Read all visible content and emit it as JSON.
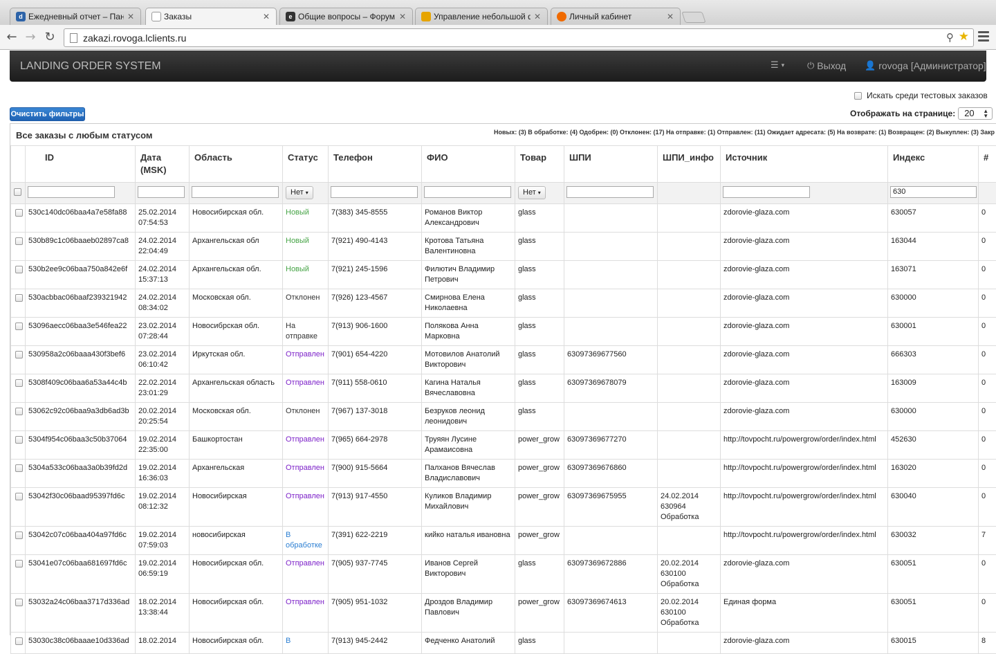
{
  "browser": {
    "tabs": [
      {
        "label": "Ежедневный отчет – Пане",
        "icon": "dashboard-favicon",
        "active": false
      },
      {
        "label": "Заказы",
        "icon": "page-favicon",
        "active": true
      },
      {
        "label": "Общие вопросы – Форум",
        "icon": "forum-favicon",
        "active": false
      },
      {
        "label": "Управление небольшой ф",
        "icon": "flag-favicon",
        "active": false
      },
      {
        "label": "Личный кабинет",
        "icon": "orange-circle-favicon",
        "active": false
      }
    ],
    "url": "zakazi.rovoga.lclients.ru"
  },
  "app": {
    "brand": "LANDING ORDER SYSTEM",
    "logout": "Выход",
    "user": "rovoga [Администратор]"
  },
  "controls": {
    "search_test_label": "Искать среди тестовых заказов",
    "clear_filters": "Очистить фильтры",
    "per_page_label": "Отображать на странице:",
    "per_page_value": "20"
  },
  "panel": {
    "title": "Все заказы с любым статусом",
    "counts": "Новых: (3) В обработке: (4) Одобрен: (0) Отклонен: (17) На отправке: (1) Отправлен: (11) Ожидает адресата: (5) На возврате: (1) Возвращен: (2) Выкуплен: (3) Закр"
  },
  "table": {
    "headers": [
      "ID",
      "Дата (MSK)",
      "Область",
      "Статус",
      "Телефон",
      "ФИО",
      "Товар",
      "ШПИ",
      "ШПИ_инфо",
      "Источник",
      "Индекс",
      "#"
    ],
    "filters": {
      "status": "Нет",
      "product": "Нет",
      "index": "630"
    },
    "rows": [
      {
        "id": "530c140dc06baa4a7e58fa88",
        "date": "25.02.2014",
        "time": "07:54:53",
        "region": "Новосибирская обл.",
        "status": "Новый",
        "status_class": "st-new",
        "phone": "7(383) 345-8555",
        "name": "Романов Виктор Александрович",
        "product": "glass",
        "spi": "",
        "spi_info": "",
        "source": "zdorovie-glaza.com",
        "index": "630057",
        "num": "0"
      },
      {
        "id": "530b89c1c06baaeb02897ca8",
        "date": "24.02.2014",
        "time": "22:04:49",
        "region": "Архангельская обл",
        "status": "Новый",
        "status_class": "st-new",
        "phone": "7(921) 490-4143",
        "name": "Кротова Татьяна Валентиновна",
        "product": "glass",
        "spi": "",
        "spi_info": "",
        "source": "zdorovie-glaza.com",
        "index": "163044",
        "num": "0"
      },
      {
        "id": "530b2ee9c06baa750a842e6f",
        "date": "24.02.2014",
        "time": "15:37:13",
        "region": "Архангельская обл.",
        "status": "Новый",
        "status_class": "st-new",
        "phone": "7(921) 245-1596",
        "name": "Филютич Владимир Петрович",
        "product": "glass",
        "spi": "",
        "spi_info": "",
        "source": "zdorovie-glaza.com",
        "index": "163071",
        "num": "0"
      },
      {
        "id": "530acbbac06baaf239321942",
        "date": "24.02.2014",
        "time": "08:34:02",
        "region": "Московская обл.",
        "status": "Отклонен",
        "status_class": "st-rej",
        "phone": "7(926) 123-4567",
        "name": "Смирнова Елена Николаевна",
        "product": "glass",
        "spi": "",
        "spi_info": "",
        "source": "zdorovie-glaza.com",
        "index": "630000",
        "num": "0"
      },
      {
        "id": "53096aecc06baa3e546fea22",
        "date": "23.02.2014",
        "time": "07:28:44",
        "region": "Новосибрская обл.",
        "status": "На отправке",
        "status_class": "st-ship",
        "phone": "7(913) 906-1600",
        "name": "Полякова Анна Марковна",
        "product": "glass",
        "spi": "",
        "spi_info": "",
        "source": "zdorovie-glaza.com",
        "index": "630001",
        "num": "0"
      },
      {
        "id": "530958a2c06baaa430f3bef6",
        "date": "23.02.2014",
        "time": "06:10:42",
        "region": "Иркутская обл.",
        "status": "Отправлен",
        "status_class": "st-sent",
        "phone": "7(901) 654-4220",
        "name": "Мотовилов Анатолий Викторович",
        "product": "glass",
        "spi": "63097369677560",
        "spi_info": "",
        "source": "zdorovie-glaza.com",
        "index": "666303",
        "num": "0"
      },
      {
        "id": "5308f409c06baa6a53a44c4b",
        "date": "22.02.2014",
        "time": "23:01:29",
        "region": "Архангельская область",
        "status": "Отправлен",
        "status_class": "st-sent",
        "phone": "7(911) 558-0610",
        "name": "Кагина Наталья Вячеславовна",
        "product": "glass",
        "spi": "63097369678079",
        "spi_info": "",
        "source": "zdorovie-glaza.com",
        "index": "163009",
        "num": "0"
      },
      {
        "id": "53062c92c06baa9a3db6ad3b",
        "date": "20.02.2014",
        "time": "20:25:54",
        "region": "Московская обл.",
        "status": "Отклонен",
        "status_class": "st-rej",
        "phone": "7(967) 137-3018",
        "name": "Безруков леонид леонидович",
        "product": "glass",
        "spi": "",
        "spi_info": "",
        "source": "zdorovie-glaza.com",
        "index": "630000",
        "num": "0"
      },
      {
        "id": "5304f954c06baa3c50b37064",
        "date": "19.02.2014",
        "time": "22:35:00",
        "region": "Башкортостан",
        "status": "Отправлен",
        "status_class": "st-sent",
        "phone": "7(965) 664-2978",
        "name": "Труяян Лусине Арамаисовна",
        "product": "power_grow",
        "spi": "63097369677270",
        "spi_info": "",
        "source": "http://tovpocht.ru/powergrow/order/index.html",
        "index": "452630",
        "num": "0"
      },
      {
        "id": "5304a533c06baa3a0b39fd2d",
        "date": "19.02.2014",
        "time": "16:36:03",
        "region": "Архангельская",
        "status": "Отправлен",
        "status_class": "st-sent",
        "phone": "7(900) 915-5664",
        "name": "Палханов Вячеслав Владиславович",
        "product": "power_grow",
        "spi": "63097369676860",
        "spi_info": "",
        "source": "http://tovpocht.ru/powergrow/order/index.html",
        "index": "163020",
        "num": "0"
      },
      {
        "id": "53042f30c06baad95397fd6c",
        "date": "19.02.2014",
        "time": "08:12:32",
        "region": "Новосибирская",
        "status": "Отправлен",
        "status_class": "st-sent",
        "phone": "7(913) 917-4550",
        "name": "Куликов Владимир Михайлович",
        "product": "power_grow",
        "spi": "63097369675955",
        "spi_info": "24.02.2014 630964 Обработка",
        "source": "http://tovpocht.ru/powergrow/order/index.html",
        "index": "630040",
        "num": "0"
      },
      {
        "id": "53042c07c06baa404a97fd6c",
        "date": "19.02.2014",
        "time": "07:59:03",
        "region": "новосибирская",
        "status": "В обработке",
        "status_class": "st-proc",
        "phone": "7(391) 622-2219",
        "name": "кийко наталья ивановна",
        "product": "power_grow",
        "spi": "",
        "spi_info": "",
        "source": "http://tovpocht.ru/powergrow/order/index.html",
        "index": "630032",
        "num": "7"
      },
      {
        "id": "53041e07c06baa681697fd6c",
        "date": "19.02.2014",
        "time": "06:59:19",
        "region": "Новосибирская обл.",
        "status": "Отправлен",
        "status_class": "st-sent",
        "phone": "7(905) 937-7745",
        "name": "Иванов Сергей Викторович",
        "product": "glass",
        "spi": "63097369672886",
        "spi_info": "20.02.2014 630100 Обработка",
        "source": "zdorovie-glaza.com",
        "index": "630051",
        "num": "0"
      },
      {
        "id": "53032a24c06baa3717d336ad",
        "date": "18.02.2014",
        "time": "13:38:44",
        "region": "Новосибирская обл.",
        "status": "Отправлен",
        "status_class": "st-sent",
        "phone": "7(905) 951-1032",
        "name": "Дроздов Владимир Павлович",
        "product": "power_grow",
        "spi": "63097369674613",
        "spi_info": "20.02.2014 630100 Обработка",
        "source": "Единая форма",
        "index": "630051",
        "num": "0"
      },
      {
        "id": "53030c38c06baaae10d336ad",
        "date": "18.02.2014",
        "time": "",
        "region": "Новосибирская обл.",
        "status": "В",
        "status_class": "st-proc",
        "phone": "7(913) 945-2442",
        "name": "Федченко Анатолий",
        "product": "glass",
        "spi": "",
        "spi_info": "",
        "source": "zdorovie-glaza.com",
        "index": "630015",
        "num": "8"
      }
    ]
  }
}
